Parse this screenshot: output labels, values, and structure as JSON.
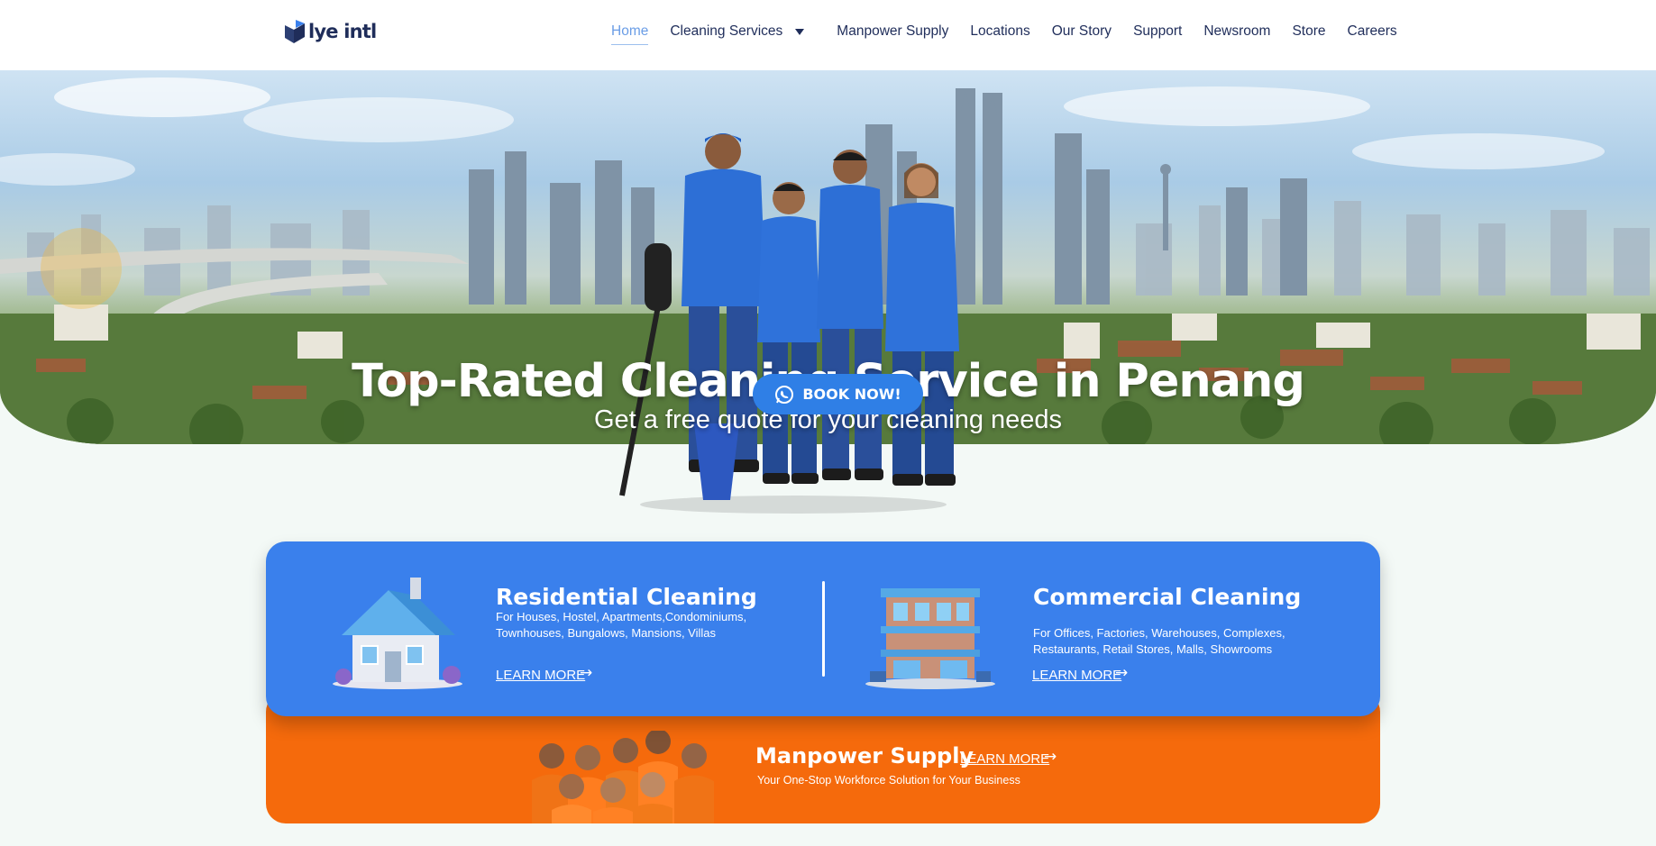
{
  "brand": {
    "name": "lye intl"
  },
  "nav": {
    "items": [
      {
        "label": "Home",
        "active": true
      },
      {
        "label": "Cleaning Services",
        "dropdown": true
      },
      {
        "label": "Manpower Supply"
      },
      {
        "label": "Locations"
      },
      {
        "label": "Our Story"
      },
      {
        "label": "Support"
      },
      {
        "label": "Newsroom"
      },
      {
        "label": "Store"
      },
      {
        "label": "Careers"
      }
    ]
  },
  "hero": {
    "title": "Top-Rated Cleaning Service in Penang",
    "subtitle": "Get a free quote for your cleaning needs",
    "cta": {
      "label": "BOOK NOW!",
      "icon": "whatsapp-icon"
    }
  },
  "services": {
    "residential": {
      "title": "Residential Cleaning",
      "desc_line1": "For Houses, Hostel, Apartments,Condominiums,",
      "desc_line2": "Townhouses, Bungalows, Mansions, Villas",
      "link": "LEARN MORE",
      "arrow": "→"
    },
    "commercial": {
      "title": "Commercial Cleaning",
      "desc_line1": "For Offices, Factories, Warehouses, Complexes,",
      "desc_line2": "Restaurants, Retail Stores, Malls, Showrooms",
      "link": "LEARN MORE",
      "arrow": "→"
    },
    "manpower": {
      "title": "Manpower Supply",
      "link": "LEARN MORE",
      "arrow": "→",
      "desc": "Your One-Stop Workforce Solution for Your Business"
    }
  },
  "colors": {
    "primary_blue": "#3a80ec",
    "button_blue": "#2f7fe6",
    "orange": "#f56a0c",
    "navy": "#1f2d5a",
    "active_nav": "#6a9de6"
  }
}
